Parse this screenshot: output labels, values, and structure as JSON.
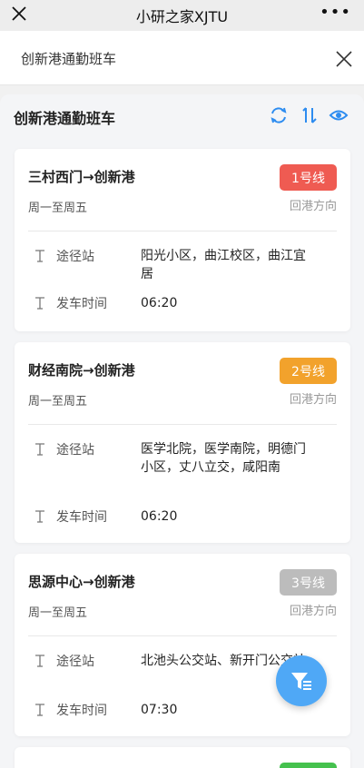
{
  "window": {
    "title": "小研之家XJTU",
    "more_label": "•••"
  },
  "header": {
    "title": "创新港通勤班车"
  },
  "panel": {
    "title": "创新港通勤班车"
  },
  "colors": {
    "accent": "#2d8cf0",
    "red": "#ef5b52",
    "orange": "#f2a22c",
    "gray": "#bcbcbc",
    "green": "#45c14e",
    "fab": "#4fa8f6"
  },
  "routes": [
    {
      "name": "三村西门→创新港",
      "days": "周一至周五",
      "line": "1号线",
      "direction": "回港方向",
      "stops_label": "途径站",
      "stops": "阳光小区，曲江校区，曲江宜居",
      "time_label": "发车时间",
      "time": "06:20"
    },
    {
      "name": "财经南院→创新港",
      "days": "周一至周五",
      "line": "2号线",
      "direction": "回港方向",
      "stops_label": "途径站",
      "stops": "医学北院，医学南院，明德门小区，丈八立交，咸阳南",
      "time_label": "发车时间",
      "time": "06:20"
    },
    {
      "name": "思源中心→创新港",
      "days": "周一至周五",
      "line": "3号线",
      "direction": "回港方向",
      "stops_label": "途径站",
      "stops": "北池头公交站、新开门公交站",
      "time_label": "发车时间",
      "time": "07:30"
    }
  ]
}
